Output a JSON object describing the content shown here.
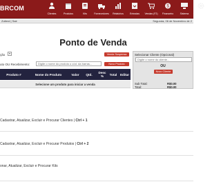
{
  "header": {
    "logo": "BRCOM",
    "nav": [
      {
        "label": "Clientes",
        "icon": "clients-icon"
      },
      {
        "label": "Produtos",
        "icon": "products-icon"
      },
      {
        "label": "Kits",
        "icon": "kits-icon"
      },
      {
        "label": "Fornecedores",
        "icon": "suppliers-icon"
      },
      {
        "label": "Relatórios",
        "icon": "reports-icon"
      },
      {
        "label": "Entradas",
        "icon": "entries-icon"
      },
      {
        "label": "Vendas (F2)",
        "icon": "sales-icon"
      },
      {
        "label": "Financeiro",
        "icon": "finance-icon"
      },
      {
        "label": "Sistema",
        "icon": "system-icon"
      },
      {
        "label": "Configurações",
        "icon": "settings-icon"
      }
    ]
  },
  "status": {
    "user": "Zolterd | Sair",
    "date": "Segunda, 06 de Novembro de 2"
  },
  "page": {
    "title": "Ponto de Venda"
  },
  "options": {
    "label": "ção",
    "select_value": "",
    "suspend_button": "Venda Suspensa"
  },
  "code_row": {
    "label": "uto OU Recebimento:",
    "placeholder": "Digite o nome do produto o cód. da barras...",
    "new_product_button": "Novo Produto"
  },
  "table": {
    "columns": [
      "Produto #",
      "Nome do Produto",
      "Valor",
      "Qtd.",
      "Desc %",
      "Total",
      "Editar"
    ],
    "empty_message": "Selecione um produto para iniciar a venda"
  },
  "client": {
    "title": "Selecionar Cliente (Opcional)",
    "placeholder": "Digite o nome do cliente...",
    "or_text": "OU",
    "new_client_button": "Novo Cliente",
    "subtotal_label": "Sub Total:",
    "subtotal_value": "R$0.00",
    "total_label": "Total:",
    "total_value": "R$0.00"
  },
  "shortcuts": [
    {
      "text": "Cadastrar, Atualizar, Excluir e Procurar Clientes | ",
      "key": "Ctrl + 1"
    },
    {
      "text": "Cadastrar, Atualizar, Excluir e Procurar Produtos | ",
      "key": "Ctrl + 2"
    },
    {
      "text": "onar, Atualizar, Excluir e Procurar Kits",
      "key": ""
    }
  ],
  "colors": {
    "header": "#8b1a1a",
    "table_header": "#23233f",
    "button": "#c63b2e"
  }
}
